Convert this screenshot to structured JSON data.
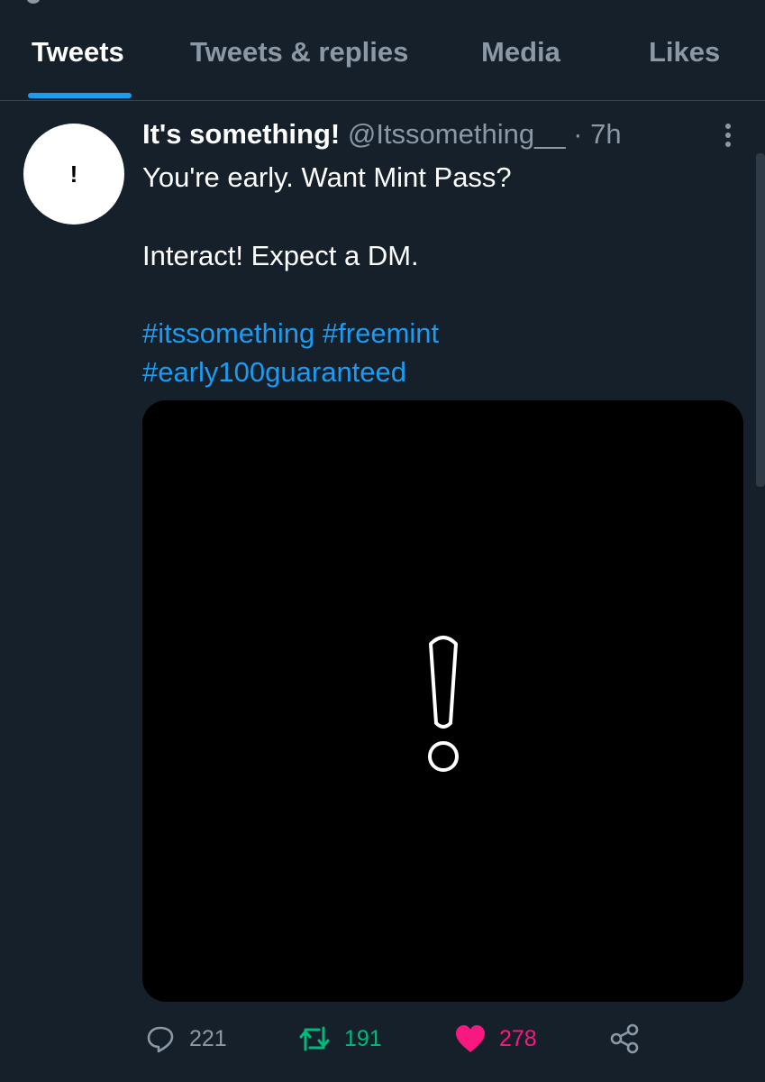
{
  "tabs": [
    {
      "label": "Tweets"
    },
    {
      "label": "Tweets & replies"
    },
    {
      "label": "Media"
    },
    {
      "label": "Likes"
    }
  ],
  "tweet": {
    "avatar_text": "!",
    "display_name": "It's something!",
    "handle": "@Itssomething__",
    "separator": "·",
    "time": "7h",
    "text_line_1": "You're early. Want Mint Pass?",
    "text_line_2": "Interact! Expect a DM.",
    "hashtag_1": "#itssomething",
    "hashtag_2": "#freemint",
    "hashtag_3": "#early100guaranteed",
    "media_icon": "exclamation-outline-icon",
    "reply_count": "221",
    "retweet_count": "191",
    "like_count": "278"
  },
  "colors": {
    "background": "#15202b",
    "accent": "#1d9bf0",
    "retweet": "#00ba7c",
    "like": "#f91880",
    "muted": "#8b98a5"
  }
}
